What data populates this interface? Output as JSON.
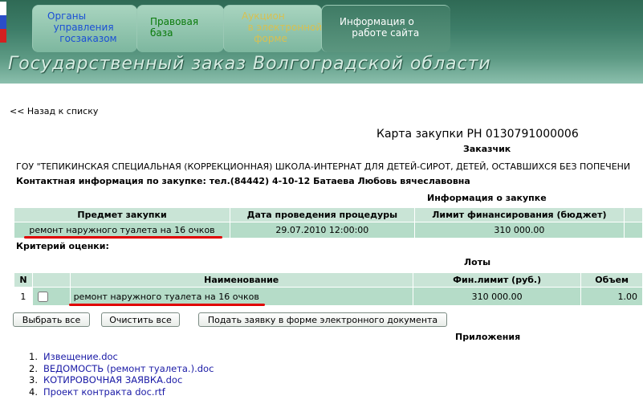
{
  "header": {
    "nav": [
      {
        "label": "Органы\n  управления\n    госзаказом"
      },
      {
        "label": "Правовая\nбаза"
      },
      {
        "label": "Аукцион\n  в электронной\n    форме"
      },
      {
        "label": "Информация о\n    работе сайта"
      }
    ],
    "title": "Государственный заказ Волгоградской области",
    "colors": {
      "nav1": "#1a4fd6",
      "nav2": "#0a7a0a",
      "nav3": "#c7b040",
      "nav4": "#ffffff"
    }
  },
  "back_link": "<< Назад к списку",
  "card_title": "Карта закупки РН 0130791000006",
  "customer_heading": "Заказчик",
  "customer_name": "ГОУ \"ТЕПИКИНСКАЯ СПЕЦИАЛЬНАЯ (КОРРЕКЦИОННАЯ) ШКОЛА-ИНТЕРНАТ ДЛЯ ДЕТЕЙ-СИРОТ, ДЕТЕЙ, ОСТАВШИХСЯ БЕЗ ПОПЕЧЕНИ",
  "contact_info": "Контактная информация по закупке: тел.(84442) 4-10-12 Батаева Любовь вячеславовна",
  "purchase_info_heading": "Информация о закупке",
  "purchase_table": {
    "headers": [
      "Предмет закупки",
      "Дата проведения процедуры",
      "Лимит финансирования (бюджет)"
    ],
    "row": [
      "ремонт наружного туалета на 16 очков",
      "29.07.2010 12:00:00",
      "310 000.00"
    ]
  },
  "criteria_label": "Критерий оценки:",
  "lots_heading": "Лоты",
  "lots_table": {
    "headers": [
      "N",
      "",
      "Наименование",
      "Фин.лимит (руб.)",
      "Объем"
    ],
    "row": {
      "n": "1",
      "name": "ремонт наружного туалета на 16 очков",
      "limit": "310 000.00",
      "volume": "1.00"
    }
  },
  "buttons": {
    "select_all": "Выбрать все",
    "clear_all": "Очистить все",
    "submit": "Подать заявку в форме электронного документа"
  },
  "attachments_heading": "Приложения",
  "attachments": [
    {
      "n": "1.",
      "label": "Извещение.doc"
    },
    {
      "n": "2.",
      "label": "ВЕДОМОСТЬ (ремонт туалета.).doc"
    },
    {
      "n": "3.",
      "label": "КОТИРОВОЧНАЯ ЗАЯВКА.doc"
    },
    {
      "n": "4.",
      "label": "Проект контракта doc.rtf"
    }
  ]
}
